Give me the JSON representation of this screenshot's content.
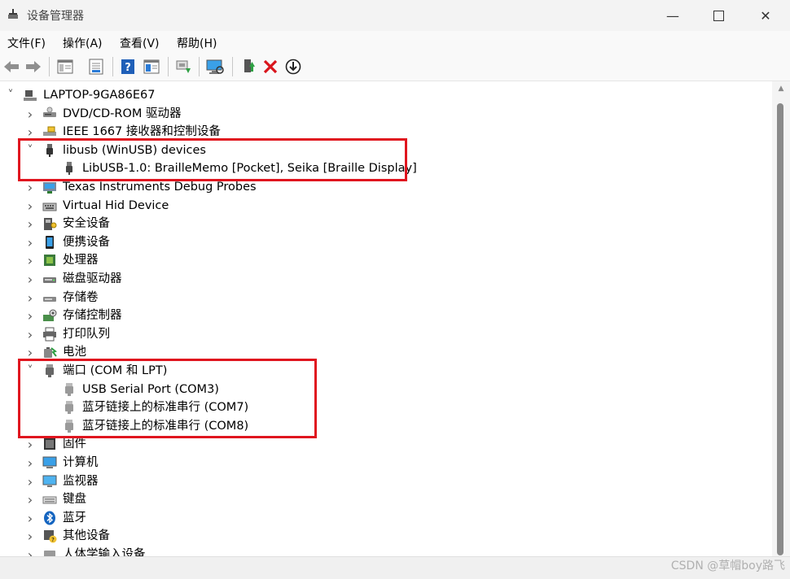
{
  "window": {
    "title": "设备管理器"
  },
  "menu": [
    "文件(F)",
    "操作(A)",
    "查看(V)",
    "帮助(H)"
  ],
  "toolbar": [
    "back-icon",
    "forward-icon",
    "properties-icon",
    "show-hide-icon",
    "help-icon",
    "view-icon",
    "update-driver-icon",
    "scan-hardware-icon",
    "enable-device-icon",
    "uninstall-icon",
    "download-icon"
  ],
  "tree": {
    "root": "LAPTOP-9GA86E67",
    "items": [
      {
        "label": "DVD/CD-ROM 驱动器",
        "icon": "dvd-drive-icon"
      },
      {
        "label": "IEEE 1667 接收器和控制设备",
        "icon": "ieee-device-icon"
      },
      {
        "label": "libusb (WinUSB) devices",
        "icon": "usb-plug-icon",
        "expanded": true,
        "children": [
          "LibUSB-1.0: BrailleMemo [Pocket], Seika [Braille Display]"
        ]
      },
      {
        "label": "Texas Instruments Debug Probes",
        "icon": "debug-probe-icon"
      },
      {
        "label": "Virtual Hid Device",
        "icon": "keyboard-hid-icon"
      },
      {
        "label": "安全设备",
        "icon": "security-device-icon"
      },
      {
        "label": "便携设备",
        "icon": "portable-device-icon"
      },
      {
        "label": "处理器",
        "icon": "processor-icon"
      },
      {
        "label": "磁盘驱动器",
        "icon": "disk-drive-icon"
      },
      {
        "label": "存储卷",
        "icon": "storage-volume-icon"
      },
      {
        "label": "存储控制器",
        "icon": "storage-controller-icon"
      },
      {
        "label": "打印队列",
        "icon": "printer-icon"
      },
      {
        "label": "电池",
        "icon": "battery-icon"
      },
      {
        "label": "端口 (COM 和 LPT)",
        "icon": "port-icon",
        "expanded": true,
        "children": [
          "USB Serial Port (COM3)",
          "蓝牙链接上的标准串行 (COM7)",
          "蓝牙链接上的标准串行 (COM8)"
        ]
      },
      {
        "label": "固件",
        "icon": "firmware-icon"
      },
      {
        "label": "计算机",
        "icon": "computer-icon"
      },
      {
        "label": "监视器",
        "icon": "monitor-icon"
      },
      {
        "label": "键盘",
        "icon": "keyboard-icon"
      },
      {
        "label": "蓝牙",
        "icon": "bluetooth-icon"
      },
      {
        "label": "其他设备",
        "icon": "other-device-icon"
      },
      {
        "label": "人体学输入设备",
        "icon": "hid-icon"
      }
    ]
  },
  "watermark": "CSDN @草帽boy路飞",
  "colors": {
    "highlight": "#e0151f",
    "bluetooth": "#1565c0",
    "accent": "#2b7bd6"
  }
}
